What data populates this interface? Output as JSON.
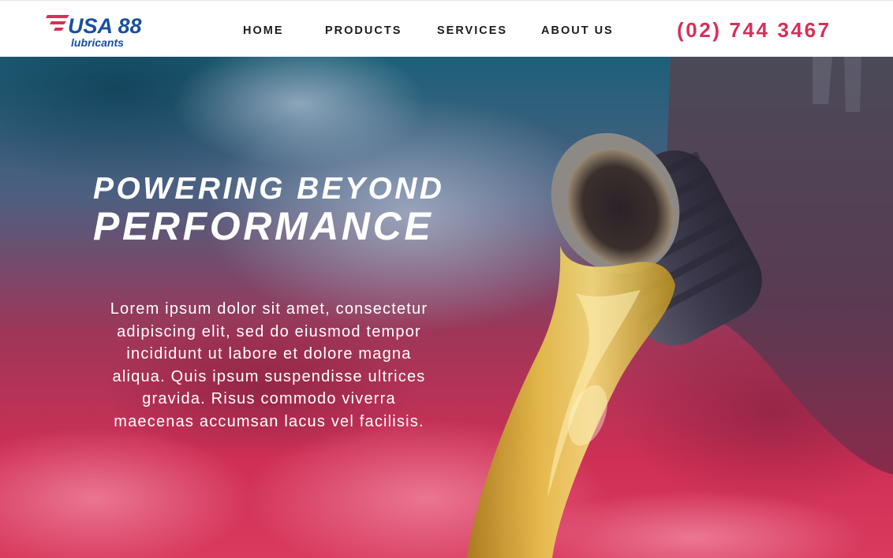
{
  "brand": {
    "name": "USA 88",
    "tagline": "lubricants",
    "colors": {
      "blue": "#1a4fa0",
      "red": "#d72f58"
    }
  },
  "nav": {
    "items": [
      {
        "label": "HOME"
      },
      {
        "label": "PRODUCTS"
      },
      {
        "label": "SERVICES"
      },
      {
        "label": "ABOUT US"
      }
    ],
    "phone": "(02) 744 3467"
  },
  "hero": {
    "title_line1": "POWERING BEYOND",
    "title_line2": "PERFORMANCE",
    "body_lines": [
      "Lorem ipsum dolor sit amet, consectetur",
      "adipiscing elit, sed do eiusmod tempor",
      "incididunt ut labore et dolore magna",
      "aliqua. Quis ipsum suspendisse ultrices",
      "gravida. Risus commodo viverra",
      "maecenas accumsan lacus vel facilisis."
    ],
    "image": "oil-pouring-from-bottle"
  }
}
